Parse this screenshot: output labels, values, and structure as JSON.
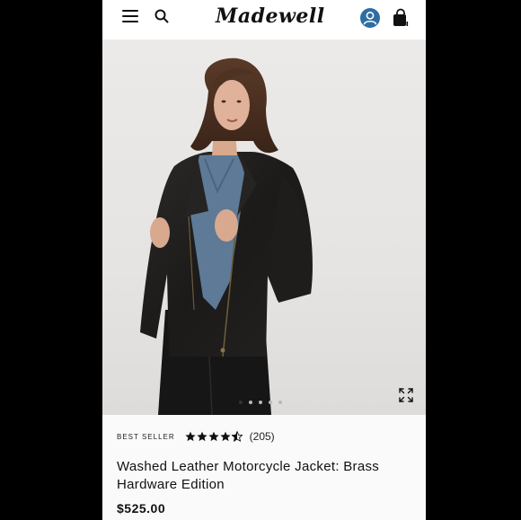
{
  "header": {
    "logo": "Madewell",
    "icons": [
      "menu-icon",
      "search-icon",
      "account-icon",
      "bag-icon"
    ],
    "accent_color": "#2e6da4"
  },
  "hero": {
    "image": "woman-in-black-leather-moto-jacket",
    "carousel": {
      "total": 5,
      "active": 1
    }
  },
  "product": {
    "badge": "BEST SELLER",
    "rating": 4.5,
    "review_count": "(205)",
    "title": "Washed Leather Motorcycle Jacket: Brass Hardware Edition",
    "price": "$525.00"
  }
}
